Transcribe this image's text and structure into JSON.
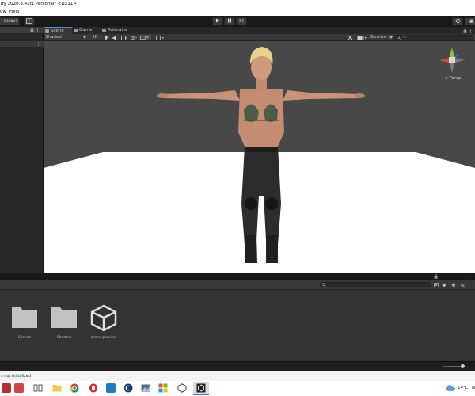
{
  "window": {
    "title": "ity 2020.3.41f1 Personal* <DX11>",
    "menu": [
      "ow",
      "Help"
    ]
  },
  "toolbar": {
    "global_label": "Global",
    "play_icon": "play-icon",
    "pause_icon": "pause-icon",
    "step_icon": "step-icon",
    "settings_icon": "gear-icon"
  },
  "scene_tabs": [
    {
      "label": "Scene",
      "icon": "grid-icon",
      "active": true
    },
    {
      "label": "Game",
      "icon": "gamepad-icon",
      "active": false
    },
    {
      "label": "Animator",
      "icon": "animator-icon",
      "active": false
    }
  ],
  "scene_bar": {
    "shading_mode": "Shaded",
    "mode_2d": "2D",
    "gizmos_label": "Gizmos",
    "search_placeholder": "All"
  },
  "gizmo": {
    "projection_label": "< Persp",
    "axis_colors": {
      "x": "#d24a3c",
      "y": "#8fc43a",
      "z": "#3b7bd8"
    }
  },
  "project": {
    "assets": [
      {
        "label": "Scenes",
        "icon": "folder-icon"
      },
      {
        "label": "Shaders",
        "icon": "folder-icon"
      },
      {
        "label": "scene preview",
        "icon": "unity-logo-icon"
      }
    ]
  },
  "status": {
    "message": "s not initialized"
  },
  "taskbar": {
    "weather": "14°C",
    "weather_suffix": "N"
  }
}
